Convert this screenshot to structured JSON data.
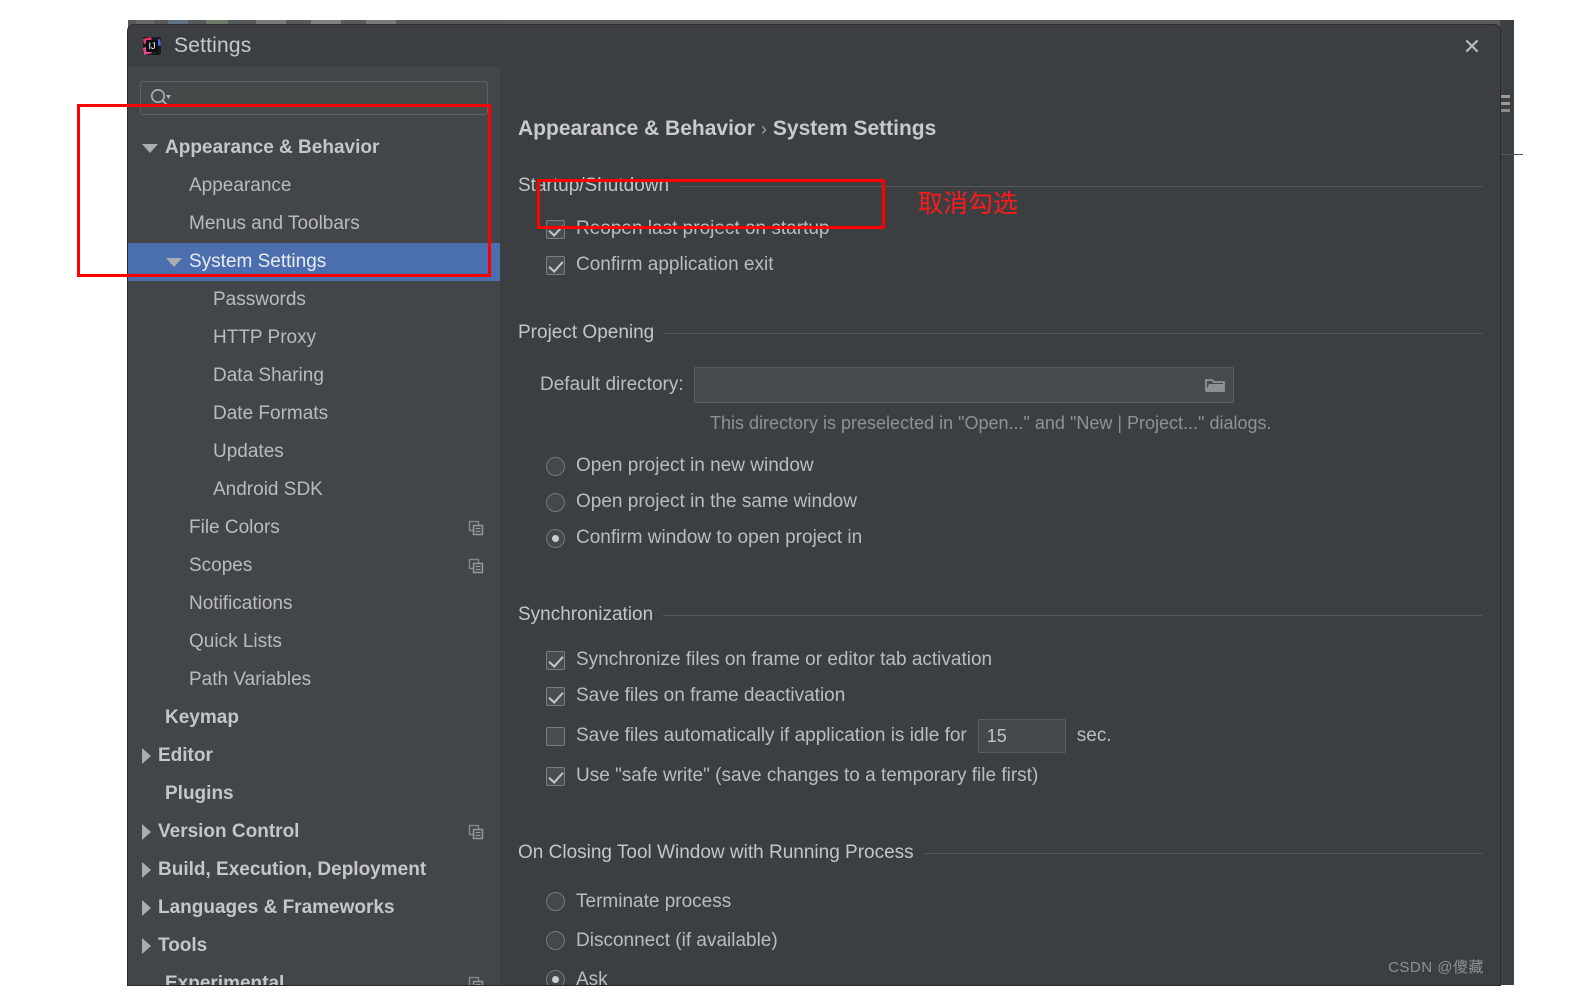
{
  "window": {
    "title": "Settings",
    "app_icon": "intellij-idea-icon",
    "close_label": "✕"
  },
  "search": {
    "value": "",
    "placeholder": "",
    "icon": "search-icon"
  },
  "sidebar": {
    "items": [
      {
        "label": "Appearance & Behavior",
        "arrow": "down",
        "indent": 0,
        "bold": true,
        "selected": false,
        "icon": null
      },
      {
        "label": "Appearance",
        "arrow": "none",
        "indent": 1,
        "bold": false,
        "selected": false,
        "icon": null
      },
      {
        "label": "Menus and Toolbars",
        "arrow": "none",
        "indent": 1,
        "bold": false,
        "selected": false,
        "icon": null
      },
      {
        "label": "System Settings",
        "arrow": "down",
        "indent": 1,
        "bold": false,
        "selected": true,
        "icon": null
      },
      {
        "label": "Passwords",
        "arrow": "none",
        "indent": 2,
        "bold": false,
        "selected": false,
        "icon": null
      },
      {
        "label": "HTTP Proxy",
        "arrow": "none",
        "indent": 2,
        "bold": false,
        "selected": false,
        "icon": null
      },
      {
        "label": "Data Sharing",
        "arrow": "none",
        "indent": 2,
        "bold": false,
        "selected": false,
        "icon": null
      },
      {
        "label": "Date Formats",
        "arrow": "none",
        "indent": 2,
        "bold": false,
        "selected": false,
        "icon": null
      },
      {
        "label": "Updates",
        "arrow": "none",
        "indent": 2,
        "bold": false,
        "selected": false,
        "icon": null
      },
      {
        "label": "Android SDK",
        "arrow": "none",
        "indent": 2,
        "bold": false,
        "selected": false,
        "icon": null
      },
      {
        "label": "File Colors",
        "arrow": "none",
        "indent": 1,
        "bold": false,
        "selected": false,
        "icon": "copy-icon"
      },
      {
        "label": "Scopes",
        "arrow": "none",
        "indent": 1,
        "bold": false,
        "selected": false,
        "icon": "copy-icon"
      },
      {
        "label": "Notifications",
        "arrow": "none",
        "indent": 1,
        "bold": false,
        "selected": false,
        "icon": null
      },
      {
        "label": "Quick Lists",
        "arrow": "none",
        "indent": 1,
        "bold": false,
        "selected": false,
        "icon": null
      },
      {
        "label": "Path Variables",
        "arrow": "none",
        "indent": 1,
        "bold": false,
        "selected": false,
        "icon": null
      },
      {
        "label": "Keymap",
        "arrow": "none",
        "indent": 0,
        "bold": true,
        "selected": false,
        "icon": null
      },
      {
        "label": "Editor",
        "arrow": "right",
        "indent": 0,
        "bold": true,
        "selected": false,
        "icon": null
      },
      {
        "label": "Plugins",
        "arrow": "none",
        "indent": 0,
        "bold": true,
        "selected": false,
        "icon": null
      },
      {
        "label": "Version Control",
        "arrow": "right",
        "indent": 0,
        "bold": true,
        "selected": false,
        "icon": "copy-icon"
      },
      {
        "label": "Build, Execution, Deployment",
        "arrow": "right",
        "indent": 0,
        "bold": true,
        "selected": false,
        "icon": null
      },
      {
        "label": "Languages & Frameworks",
        "arrow": "right",
        "indent": 0,
        "bold": true,
        "selected": false,
        "icon": null
      },
      {
        "label": "Tools",
        "arrow": "right",
        "indent": 0,
        "bold": true,
        "selected": false,
        "icon": null
      },
      {
        "label": "Experimental",
        "arrow": "none",
        "indent": 0,
        "bold": true,
        "selected": false,
        "icon": "copy-icon"
      }
    ]
  },
  "breadcrumb": {
    "root": "Appearance & Behavior",
    "separator": "›",
    "current": "System Settings"
  },
  "sections": {
    "startup": {
      "title": "Startup/Shutdown",
      "options": [
        {
          "label": "Reopen last project on startup",
          "checked": true
        },
        {
          "label": "Confirm application exit",
          "checked": true
        }
      ]
    },
    "project_opening": {
      "title": "Project Opening",
      "dir_label": "Default directory:",
      "dir_value": "",
      "dir_placeholder": "",
      "browse_icon": "folder-icon",
      "hint": "This directory is preselected in \"Open...\" and \"New | Project...\" dialogs.",
      "radios": [
        {
          "label": "Open project in new window",
          "selected": false
        },
        {
          "label": "Open project in the same window",
          "selected": false
        },
        {
          "label": "Confirm window to open project in",
          "selected": true
        }
      ]
    },
    "synchronization": {
      "title": "Synchronization",
      "options": [
        {
          "label": "Synchronize files on frame or editor tab activation",
          "checked": true
        },
        {
          "label": "Save files on frame deactivation",
          "checked": true
        },
        {
          "label": "Save files automatically if application is idle for",
          "checked": false
        },
        {
          "label": "Use \"safe write\" (save changes to a temporary file first)",
          "checked": true
        }
      ],
      "idle_seconds": "15",
      "sec_label": "sec."
    },
    "closing_tool_window": {
      "title": "On Closing Tool Window with Running Process",
      "radios": [
        {
          "label": "Terminate process",
          "selected": false
        },
        {
          "label": "Disconnect (if available)",
          "selected": false
        },
        {
          "label": "Ask",
          "selected": true
        }
      ]
    }
  },
  "annotations": {
    "note_text": "取消勾选",
    "accent_color": "#ff0000"
  },
  "watermark": {
    "text": "CSDN @傻藏"
  }
}
